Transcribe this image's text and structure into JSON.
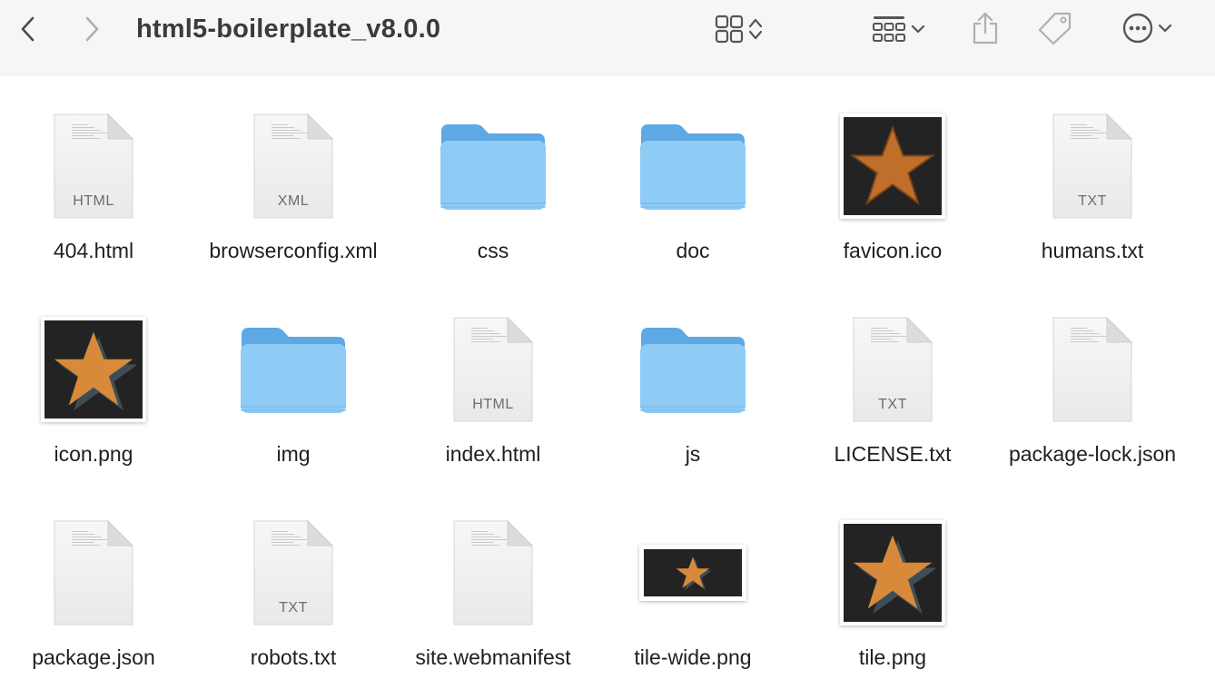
{
  "window": {
    "title": "html5-boilerplate_v8.0.0"
  },
  "toolbar": {
    "back": "chevron-left-icon",
    "forward": "chevron-right-icon",
    "view": "icon-grid-icon",
    "group": "group-by-icon",
    "share": "share-icon",
    "tag": "tag-icon",
    "more": "ellipsis-circle-icon"
  },
  "colors": {
    "folder_top": "#5ea8e3",
    "folder_body": "#8ecbf5",
    "star_orange": "#d88a3a",
    "thumb_bg": "#232323"
  },
  "files": [
    {
      "name": "404.html",
      "kind": "doc",
      "ext": "HTML"
    },
    {
      "name": "browserconfig.xml",
      "kind": "doc",
      "ext": "XML"
    },
    {
      "name": "css",
      "kind": "folder"
    },
    {
      "name": "doc",
      "kind": "folder"
    },
    {
      "name": "favicon.ico",
      "kind": "image-pixel"
    },
    {
      "name": "humans.txt",
      "kind": "doc",
      "ext": "TXT"
    },
    {
      "name": "icon.png",
      "kind": "image-star"
    },
    {
      "name": "img",
      "kind": "folder"
    },
    {
      "name": "index.html",
      "kind": "doc",
      "ext": "HTML"
    },
    {
      "name": "js",
      "kind": "folder"
    },
    {
      "name": "LICENSE.txt",
      "kind": "doc",
      "ext": "TXT"
    },
    {
      "name": "package-lock.json",
      "kind": "doc"
    },
    {
      "name": "package.json",
      "kind": "doc"
    },
    {
      "name": "robots.txt",
      "kind": "doc",
      "ext": "TXT"
    },
    {
      "name": "site.webmanifest",
      "kind": "doc"
    },
    {
      "name": "tile-wide.png",
      "kind": "image-wide"
    },
    {
      "name": "tile.png",
      "kind": "image-star"
    }
  ]
}
